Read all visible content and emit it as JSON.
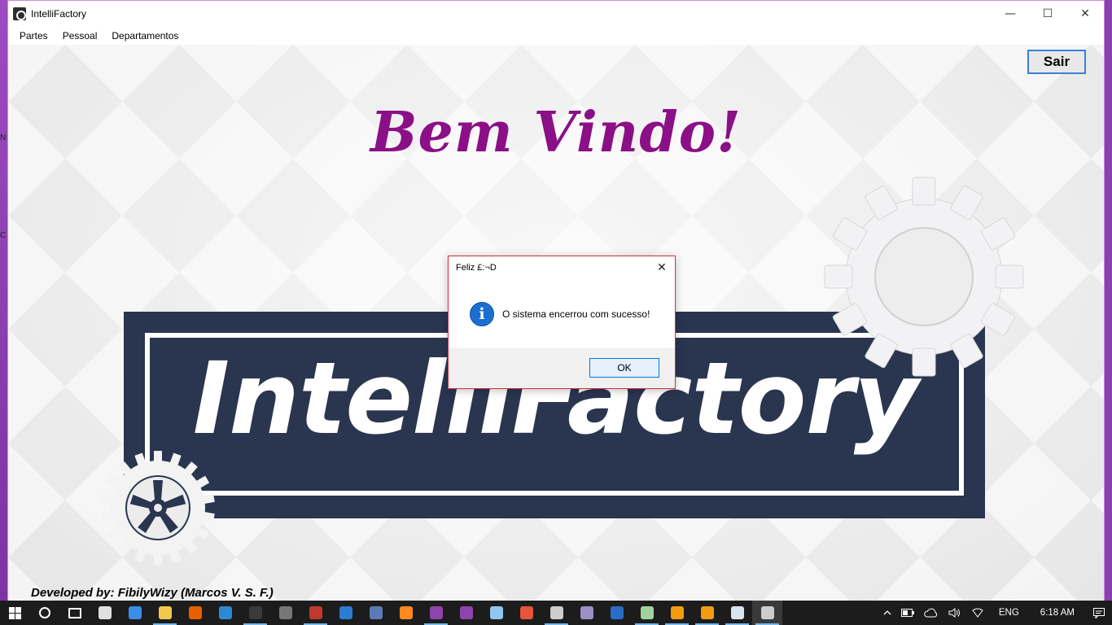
{
  "window": {
    "title": "IntelliFactory",
    "controls": {
      "minimize": "—",
      "maximize": "☐",
      "close": "✕"
    }
  },
  "menu": [
    "Partes",
    "Pessoal",
    "Departamentos"
  ],
  "content": {
    "exit_button": "Sair",
    "welcome": "Bem Vindo!",
    "logo_text": "IntelliFactory",
    "developer": "Developed by: FibilyWizy (Marcos V. S. F.)"
  },
  "dialog": {
    "title": "Feliz £:¬D",
    "message": "O sistema encerrou com sucesso!",
    "ok_label": "OK",
    "icon": "info-icon",
    "close": "✕"
  },
  "taskbar": {
    "apps": [
      {
        "name": "search",
        "color": "#ffffff"
      },
      {
        "name": "task-view",
        "color": "#ffffff"
      },
      {
        "name": "store",
        "color": "#e0e0e0"
      },
      {
        "name": "edge",
        "color": "#3b8ee8"
      },
      {
        "name": "file-explorer",
        "color": "#f2c94c"
      },
      {
        "name": "firefox",
        "color": "#e66000"
      },
      {
        "name": "internet-explorer",
        "color": "#2a8ad4"
      },
      {
        "name": "netbeans",
        "color": "#3a3a3a"
      },
      {
        "name": "inkscape",
        "color": "#777777"
      },
      {
        "name": "access",
        "color": "#c0392b"
      },
      {
        "name": "vscode",
        "color": "#2b7bd0"
      },
      {
        "name": "database-tool",
        "color": "#5a7bb5"
      },
      {
        "name": "box-app",
        "color": "#ff8a1f"
      },
      {
        "name": "visual-studio-2",
        "color": "#8e44ad"
      },
      {
        "name": "visual-studio",
        "color": "#8e44ad"
      },
      {
        "name": "virtualbox",
        "color": "#8fc7f0"
      },
      {
        "name": "weibo",
        "color": "#e6543c"
      },
      {
        "name": "gimp",
        "color": "#cccccc"
      },
      {
        "name": "obs",
        "color": "#9b8fc5"
      },
      {
        "name": "browser",
        "color": "#2b6cc4"
      },
      {
        "name": "notes",
        "color": "#9fd39b"
      },
      {
        "name": "vlc",
        "color": "#f39c12"
      },
      {
        "name": "media-player",
        "color": "#f39c12"
      },
      {
        "name": "document",
        "color": "#d8e4f0"
      },
      {
        "name": "intellifactory",
        "color": "#cccccc"
      }
    ],
    "language": "ENG",
    "time": "6:18 AM"
  }
}
